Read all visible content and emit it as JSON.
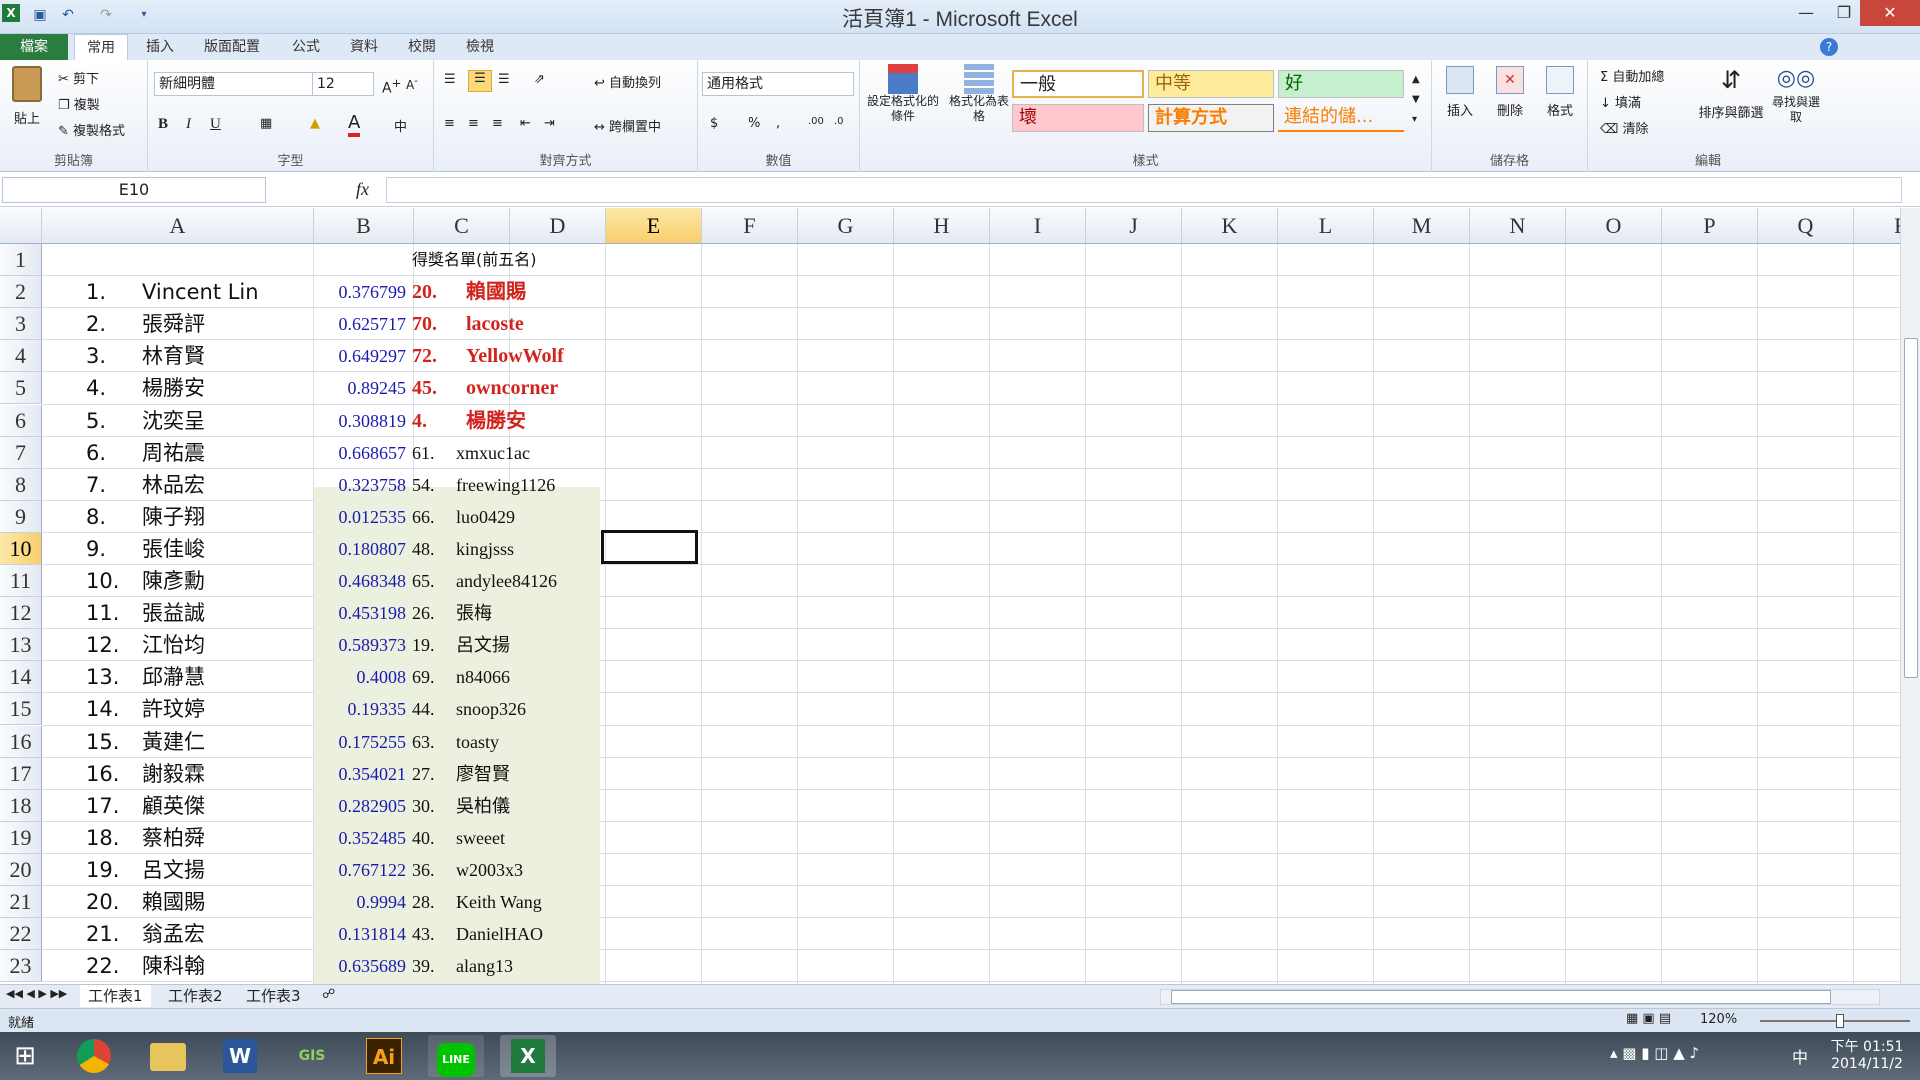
{
  "window": {
    "title": "活頁簿1 - Microsoft Excel"
  },
  "tabs": [
    "檔案",
    "常用",
    "插入",
    "版面配置",
    "公式",
    "資料",
    "校閱",
    "檢視"
  ],
  "ribbon": {
    "clipboard": {
      "paste": "貼上",
      "cut": "剪下",
      "copy": "複製",
      "format_painter": "複製格式",
      "label": "剪貼簿"
    },
    "font": {
      "name": "新細明體",
      "size": "12",
      "label": "字型"
    },
    "alignment": {
      "wrap": "自動換列",
      "merge": "跨欄置中",
      "label": "對齊方式"
    },
    "number": {
      "format": "通用格式",
      "label": "數值"
    },
    "styles": {
      "cond": "設定格式化的條件",
      "table": "格式化為表格",
      "normal": "一般",
      "neutral": "中等",
      "good": "好",
      "bad": "壞",
      "calc": "計算方式",
      "link": "連結的儲...",
      "label": "樣式"
    },
    "cells": {
      "insert": "插入",
      "delete": "刪除",
      "format": "格式",
      "label": "儲存格"
    },
    "editing": {
      "autosum": "自動加總",
      "fill": "填滿",
      "clear": "清除",
      "sort": "排序與篩選",
      "find": "尋找與選取",
      "label": "編輯"
    }
  },
  "formula_bar": {
    "name_box": "E10",
    "fx": "fx",
    "value": ""
  },
  "columns": [
    "A",
    "B",
    "C",
    "D",
    "E",
    "F",
    "G",
    "H",
    "I",
    "J",
    "K",
    "L",
    "M",
    "N",
    "O",
    "P",
    "Q",
    "R"
  ],
  "rows": [
    "1",
    "2",
    "3",
    "4",
    "5",
    "6",
    "7",
    "8",
    "9",
    "10",
    "11",
    "12",
    "13",
    "14",
    "15",
    "16",
    "17",
    "18",
    "19",
    "20",
    "21",
    "22",
    "23"
  ],
  "header_c1": "得獎名單(前五名)",
  "data": [
    {
      "num": "1.",
      "name": "Vincent Lin",
      "b": "0.376799",
      "cnum": "20.",
      "cname": "賴國賜",
      "win": true
    },
    {
      "num": "2.",
      "name": "張舜評",
      "b": "0.625717",
      "cnum": "70.",
      "cname": "lacoste",
      "win": true
    },
    {
      "num": "3.",
      "name": "林育賢",
      "b": "0.649297",
      "cnum": "72.",
      "cname": "YellowWolf",
      "win": true
    },
    {
      "num": "4.",
      "name": "楊勝安",
      "b": "0.89245",
      "cnum": "45.",
      "cname": "owncorner",
      "win": true
    },
    {
      "num": "5.",
      "name": "沈奕呈",
      "b": "0.308819",
      "cnum": "4.",
      "cname": "楊勝安",
      "win": true
    },
    {
      "num": "6.",
      "name": "周祐震",
      "b": "0.668657",
      "cnum": "61.",
      "cname": "xmxuc1ac",
      "win": false
    },
    {
      "num": "7.",
      "name": "林品宏",
      "b": "0.323758",
      "cnum": "54.",
      "cname": "freewing1126",
      "win": false
    },
    {
      "num": "8.",
      "name": "陳子翔",
      "b": "0.012535",
      "cnum": "66.",
      "cname": "luo0429",
      "win": false
    },
    {
      "num": "9.",
      "name": "張佳峻",
      "b": "0.180807",
      "cnum": "48.",
      "cname": "kingjsss",
      "win": false
    },
    {
      "num": "10.",
      "name": "陳彥勳",
      "b": "0.468348",
      "cnum": "65.",
      "cname": "andylee84126",
      "win": false
    },
    {
      "num": "11.",
      "name": "張益誠",
      "b": "0.453198",
      "cnum": "26.",
      "cname": "張梅",
      "win": false
    },
    {
      "num": "12.",
      "name": "江怡均",
      "b": "0.589373",
      "cnum": "19.",
      "cname": "呂文揚",
      "win": false
    },
    {
      "num": "13.",
      "name": "邱瀞慧",
      "b": "0.4008",
      "cnum": "69.",
      "cname": "n84066",
      "win": false
    },
    {
      "num": "14.",
      "name": "許玟婷",
      "b": "0.19335",
      "cnum": "44.",
      "cname": "snoop326",
      "win": false
    },
    {
      "num": "15.",
      "name": "黃建仁",
      "b": "0.175255",
      "cnum": "63.",
      "cname": "toasty",
      "win": false
    },
    {
      "num": "16.",
      "name": "謝毅霖",
      "b": "0.354021",
      "cnum": "27.",
      "cname": "廖智賢",
      "win": false
    },
    {
      "num": "17.",
      "name": "顧英傑",
      "b": "0.282905",
      "cnum": "30.",
      "cname": "吳柏儀",
      "win": false
    },
    {
      "num": "18.",
      "name": "蔡柏舜",
      "b": "0.352485",
      "cnum": "40.",
      "cname": "sweeet",
      "win": false
    },
    {
      "num": "19.",
      "name": "呂文揚",
      "b": "0.767122",
      "cnum": "36.",
      "cname": "w2003x3",
      "win": false
    },
    {
      "num": "20.",
      "name": "賴國賜",
      "b": "0.9994",
      "cnum": "28.",
      "cname": "Keith Wang",
      "win": false
    },
    {
      "num": "21.",
      "name": "翁孟宏",
      "b": "0.131814",
      "cnum": "43.",
      "cname": "DanielHAO",
      "win": false
    },
    {
      "num": "22.",
      "name": "陳科翰",
      "b": "0.635689",
      "cnum": "39.",
      "cname": "alang13",
      "win": false
    }
  ],
  "sheets": [
    "工作表1",
    "工作表2",
    "工作表3"
  ],
  "status": {
    "ready": "就緒",
    "zoom": "120%"
  },
  "taskbar": {
    "apps": [
      "chrome",
      "explorer",
      "word",
      "gis",
      "illustrator",
      "line",
      "excel"
    ],
    "ime": "中",
    "time_ampm": "下午 01:51",
    "date": "2014/11/2"
  },
  "colors": {
    "winner": "#d2231e",
    "bcol": "#1a1ab0",
    "fill": "#ebf1de",
    "file_tab": "#2a7c3f"
  }
}
